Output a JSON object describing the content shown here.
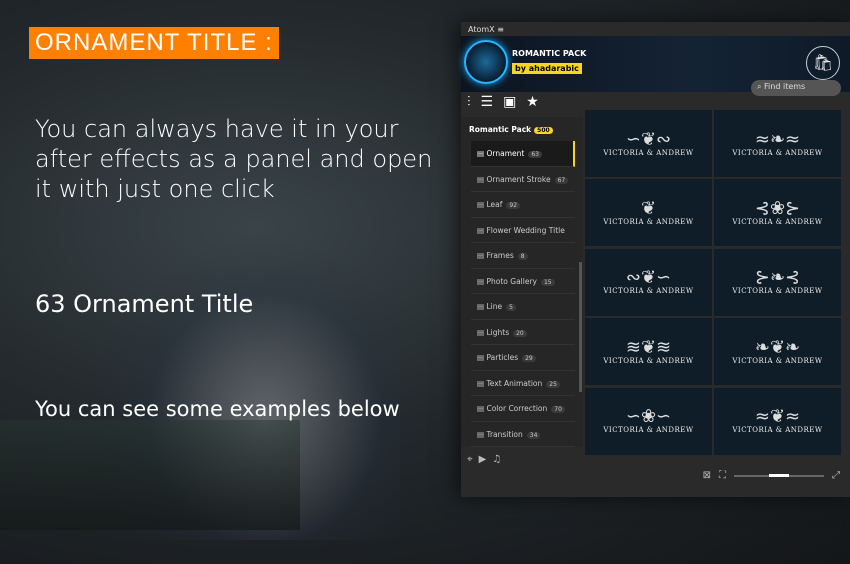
{
  "heading": "ORNAMENT TITLE :",
  "description": "You can always have it in your after effects as a panel and open it with just one click",
  "count_text": "63 Ornament Title",
  "examples_text": "You can see some examples below",
  "panel": {
    "app_name": "AtomX",
    "pack_title": "ROMANTIC PACK",
    "author": "by ahadarabic",
    "search_placeholder": "Find items",
    "sidebar_header": "Romantic Pack",
    "sidebar_badge": "500",
    "categories": [
      {
        "label": "Ornament",
        "count": "63"
      },
      {
        "label": "Ornament Stroke",
        "count": "67"
      },
      {
        "label": "Leaf",
        "count": "92"
      },
      {
        "label": "Flower Wedding Title",
        "count": ""
      },
      {
        "label": "Frames",
        "count": "8"
      },
      {
        "label": "Photo Gallery",
        "count": "15"
      },
      {
        "label": "Line",
        "count": "5"
      },
      {
        "label": "Lights",
        "count": "20"
      },
      {
        "label": "Particles",
        "count": "29"
      },
      {
        "label": "Text Animation",
        "count": "25"
      },
      {
        "label": "Color Correction",
        "count": "70"
      },
      {
        "label": "Transition",
        "count": "34"
      }
    ],
    "item_text": "VICTORIA & ANDREW",
    "accent": "#f7d622"
  }
}
